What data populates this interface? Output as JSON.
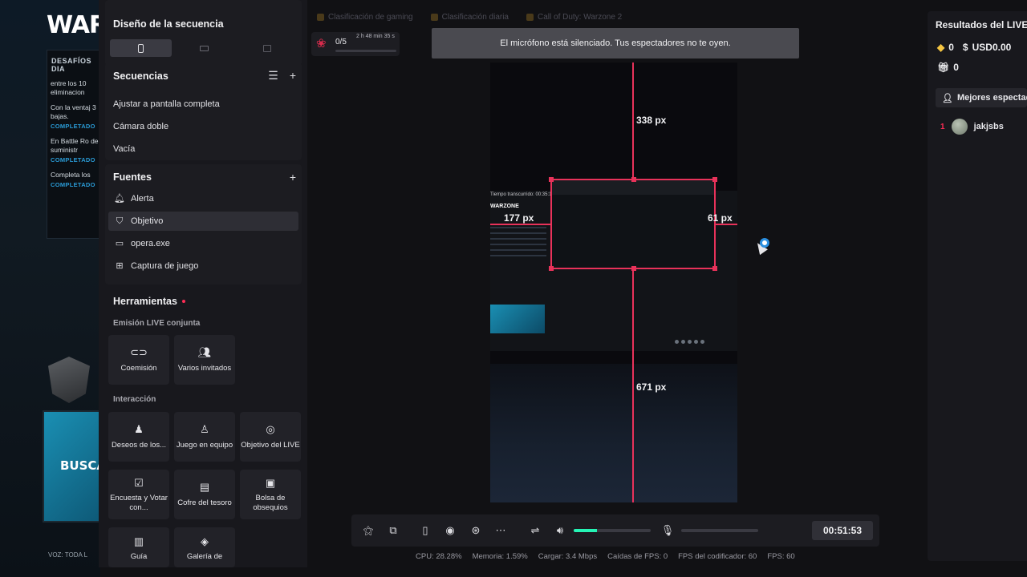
{
  "background_game": {
    "logo": "WAR",
    "challenges_title": "DESAFÍOS DIA",
    "challenges": [
      {
        "text": "entre los 10 eliminacion",
        "status": ""
      },
      {
        "text": "Con la ventaj 3 bajas.",
        "status": "COMPLETADO"
      },
      {
        "text": "En Battle Ro de suministr",
        "status": "COMPLETADO"
      },
      {
        "text": "Completa los",
        "status": "COMPLETADO"
      }
    ],
    "search_banner": "BUSCAR",
    "voice_text": "VOZ: TODA L"
  },
  "left_panel": {
    "layout_title": "Diseño de la secuencia",
    "sequences": {
      "title": "Secuencias",
      "items": [
        "Ajustar a pantalla completa",
        "Cámara doble",
        "Vacía"
      ]
    },
    "sources": {
      "title": "Fuentes",
      "items": [
        {
          "label": "Alerta",
          "icon": "bell-icon",
          "active": false
        },
        {
          "label": "Objetivo",
          "icon": "shield-icon",
          "active": true
        },
        {
          "label": "opera.exe",
          "icon": "window-icon",
          "active": false
        },
        {
          "label": "Captura de juego",
          "icon": "gamepad-icon",
          "active": false
        }
      ]
    },
    "tools": {
      "title": "Herramientas",
      "joint_title": "Emisión LIVE conjunta",
      "joint": [
        {
          "label": "Coemisión",
          "icon": "link-icon"
        },
        {
          "label": "Varios invitados",
          "icon": "users-icon"
        }
      ],
      "interaction_title": "Interacción",
      "interaction": [
        {
          "label": "Deseos de los...",
          "icon": "wishes-icon"
        },
        {
          "label": "Juego en equipo",
          "icon": "team-icon"
        },
        {
          "label": "Objetivo del LIVE",
          "icon": "target-icon"
        },
        {
          "label": "Encuesta y Votar con...",
          "icon": "poll-icon"
        },
        {
          "label": "Cofre del tesoro",
          "icon": "chest-icon"
        },
        {
          "label": "Bolsa de obsequios",
          "icon": "gift-bag-icon"
        },
        {
          "label": "Guía",
          "icon": "guide-icon"
        },
        {
          "label": "Galería de",
          "icon": "gallery-icon"
        }
      ]
    }
  },
  "top_tabs": [
    "Clasificación de gaming",
    "Clasificación diaria",
    "Call of Duty: Warzone 2"
  ],
  "goal_widget": {
    "count": "0/5",
    "time": "2 h 48 min 35 s",
    "progress": 0
  },
  "toast": "El micrófono está silenciado. Tus espectadores no te oyen.",
  "preview": {
    "measure_top": "338 px",
    "measure_left": "177 px",
    "measure_right": "61 px",
    "measure_bottom": "671 px",
    "game_header": "Tiempo transcurrido: 00:35:1",
    "game_logo": "WARZONE"
  },
  "controls": {
    "volume_level": 0.3,
    "timer": "00:51:53"
  },
  "stats": [
    "CPU: 28.28%",
    "Memoria: 1.59%",
    "Cargar: 3.4 Mbps",
    "Caídas de FPS: 0",
    "FPS del codificador: 60",
    "FPS: 60"
  ],
  "right_panel": {
    "title": "Resultados del LIVE",
    "diamonds": "0",
    "usd": "USD0.00",
    "gifts": "0",
    "top_viewers_label": "Mejores espectad",
    "top_viewer": {
      "rank": "1",
      "name": "jakjsbs"
    }
  },
  "colors": {
    "accent": "#fe2c55",
    "selection": "#e8325a",
    "volume": "#25f4b5"
  }
}
